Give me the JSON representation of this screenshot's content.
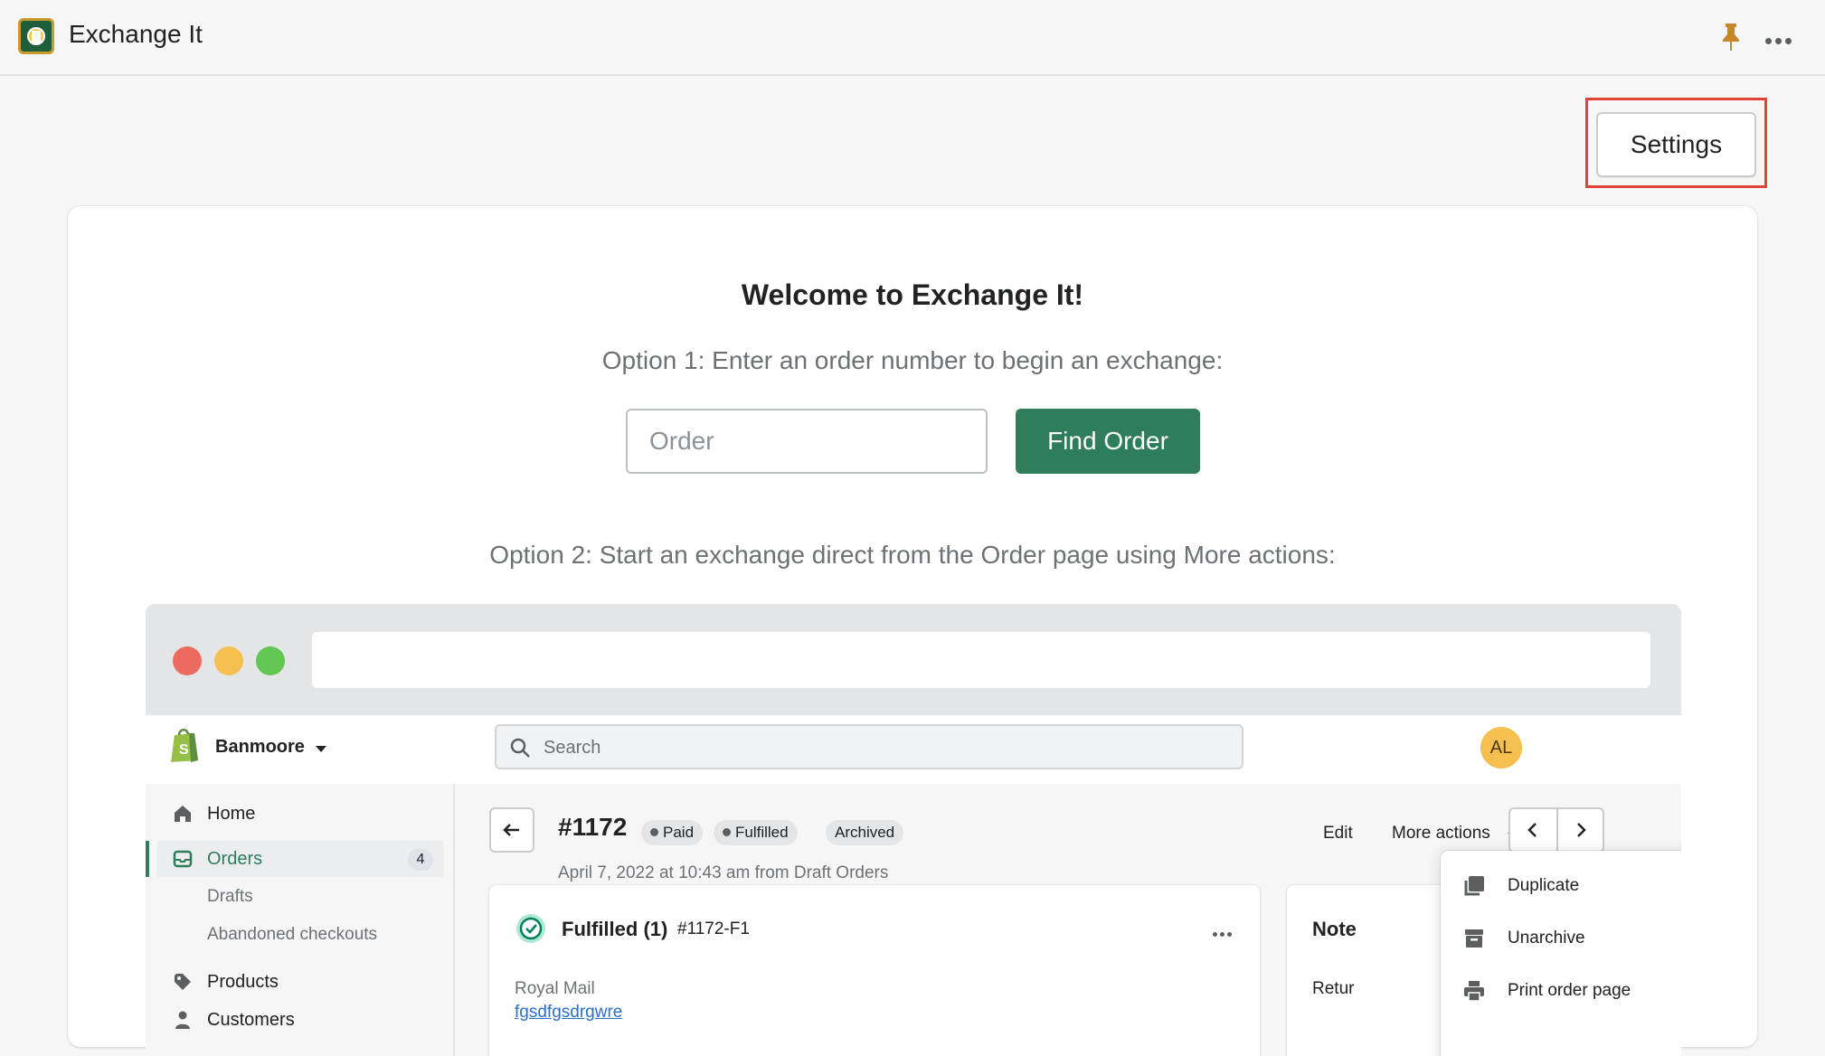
{
  "app": {
    "title": "Exchange It"
  },
  "header": {
    "settings_label": "Settings"
  },
  "main": {
    "welcome": "Welcome to Exchange It!",
    "option1": "Option 1: Enter an order number to begin an exchange:",
    "order_placeholder": "Order",
    "find_order_label": "Find Order",
    "option2": "Option 2: Start an exchange direct from the Order page using More actions:"
  },
  "mockup": {
    "shop_name": "Banmoore",
    "search_placeholder": "Search",
    "avatar_initials": "AL",
    "nav": [
      {
        "label": "Home",
        "icon": "home-icon"
      },
      {
        "label": "Orders",
        "icon": "orders-icon",
        "count": "4"
      },
      {
        "label": "Drafts"
      },
      {
        "label": "Abandoned checkouts"
      },
      {
        "label": "Products",
        "icon": "tag-icon"
      },
      {
        "label": "Customers",
        "icon": "person-icon"
      }
    ],
    "order": {
      "number": "#1172",
      "badges": [
        "Paid",
        "Fulfilled",
        "Archived"
      ],
      "date": "April 7, 2022 at 10:43 am from Draft Orders",
      "edit_label": "Edit",
      "more_actions_label": "More actions"
    },
    "fulfilled": {
      "title": "Fulfilled (1)",
      "id": "#1172-F1",
      "carrier": "Royal Mail",
      "tracking": "fgsdfgsdrgwre"
    },
    "notes": {
      "title": "Note",
      "text": "Retur"
    },
    "dropdown": [
      "Duplicate",
      "Unarchive",
      "Print order page"
    ]
  },
  "colors": {
    "accent": "#2e7d5b",
    "highlight": "#e0433a",
    "avatar": "#f5c04f"
  }
}
